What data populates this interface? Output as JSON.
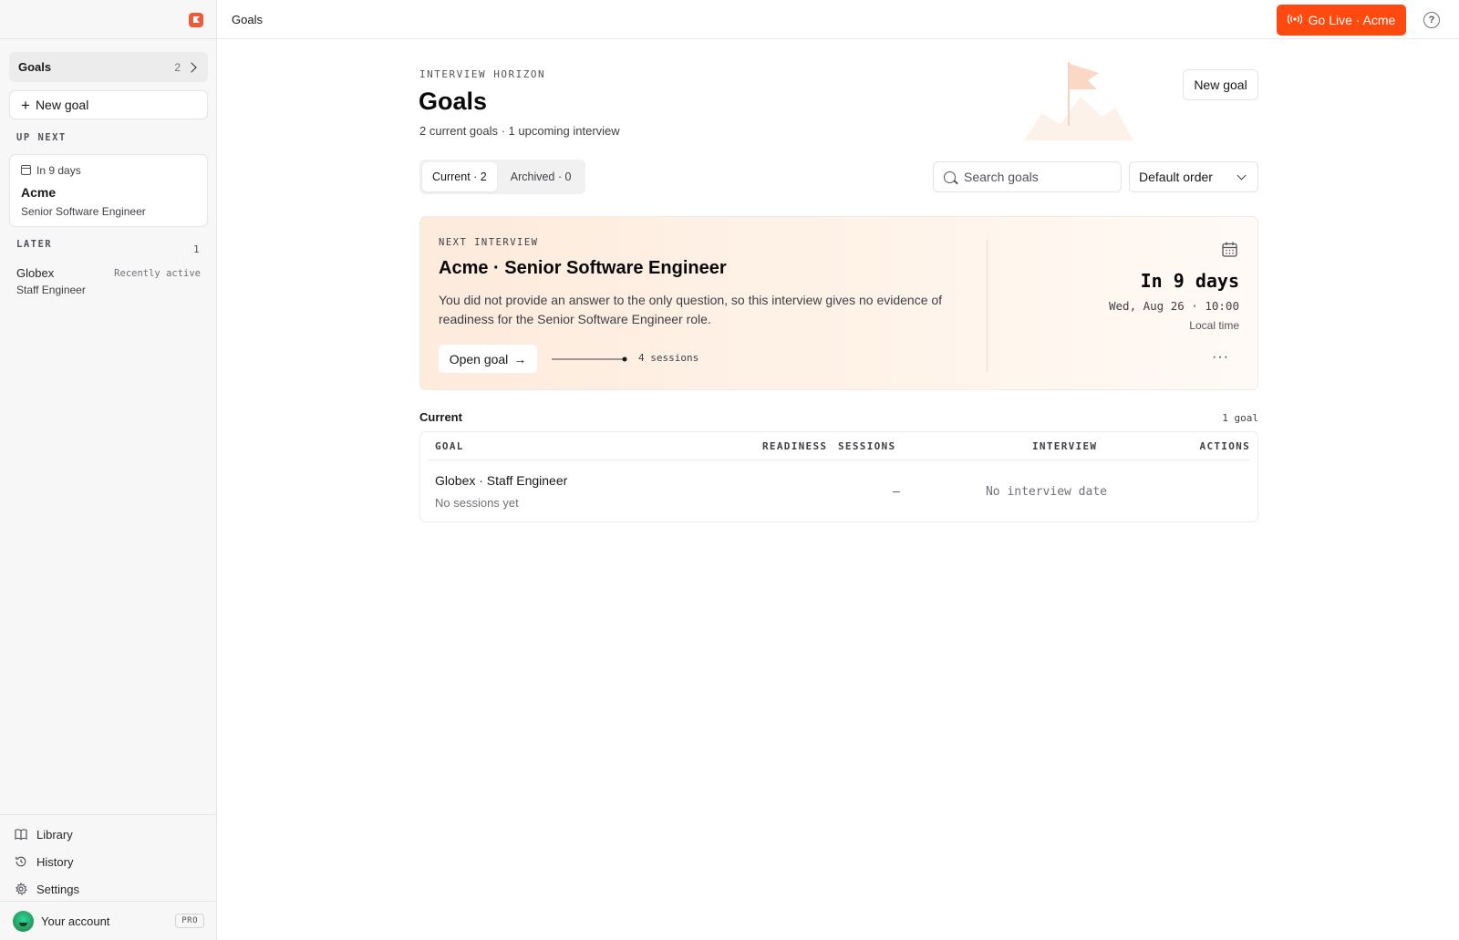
{
  "sidebar": {
    "goals_label": "Goals",
    "goals_count": "2",
    "new_goal_label": "New goal",
    "up_next_label": "UP NEXT",
    "up_next": {
      "when": "In 9 days",
      "company": "Acme",
      "role": "Senior Software Engineer"
    },
    "later_label": "LATER",
    "later_count": "1",
    "later_items": [
      {
        "company": "Globex",
        "status": "Recently active",
        "role": "Staff Engineer"
      }
    ],
    "nav": [
      {
        "label": "Library",
        "icon": "book-icon"
      },
      {
        "label": "History",
        "icon": "history-icon"
      },
      {
        "label": "Settings",
        "icon": "gear-icon"
      }
    ],
    "account_label": "Your account",
    "plan_badge": "PRO"
  },
  "topbar": {
    "breadcrumb": "Goals",
    "go_live_label": "Go Live · Acme",
    "help_icon": "?"
  },
  "header": {
    "eyebrow": "INTERVIEW HORIZON",
    "title": "Goals",
    "subtitle": "2 current goals · 1 upcoming interview",
    "new_goal_label": "New goal"
  },
  "filters": {
    "tabs": [
      {
        "label": "Current · 2",
        "active": true
      },
      {
        "label": "Archived · 0",
        "active": false
      }
    ],
    "search_placeholder": "Search goals",
    "sort_value": "Default order"
  },
  "next_interview": {
    "eyebrow": "NEXT INTERVIEW",
    "title": "Acme · Senior Software Engineer",
    "description": "You did not provide an answer to the only question, so this interview gives no evidence of readiness for the Senior Software Engineer role.",
    "open_label": "Open goal",
    "sessions": "4 sessions",
    "countdown": "In 9 days",
    "datetime": "Wed, Aug 26 · 10:00",
    "timezone": "Local time",
    "more_label": "···"
  },
  "current_section": {
    "label": "Current",
    "count": "1 goal",
    "columns": [
      "GOAL",
      "READINESS",
      "SESSIONS",
      "INTERVIEW",
      "ACTIONS"
    ],
    "rows": [
      {
        "title": "Globex · Staff Engineer",
        "subtitle": "No sessions yet",
        "readiness": "",
        "sessions": "–",
        "interview": "No interview date"
      }
    ]
  },
  "colors": {
    "accent": "#ff4a0f",
    "logo": "#f05a3a",
    "hero_start": "#fdebdc"
  }
}
